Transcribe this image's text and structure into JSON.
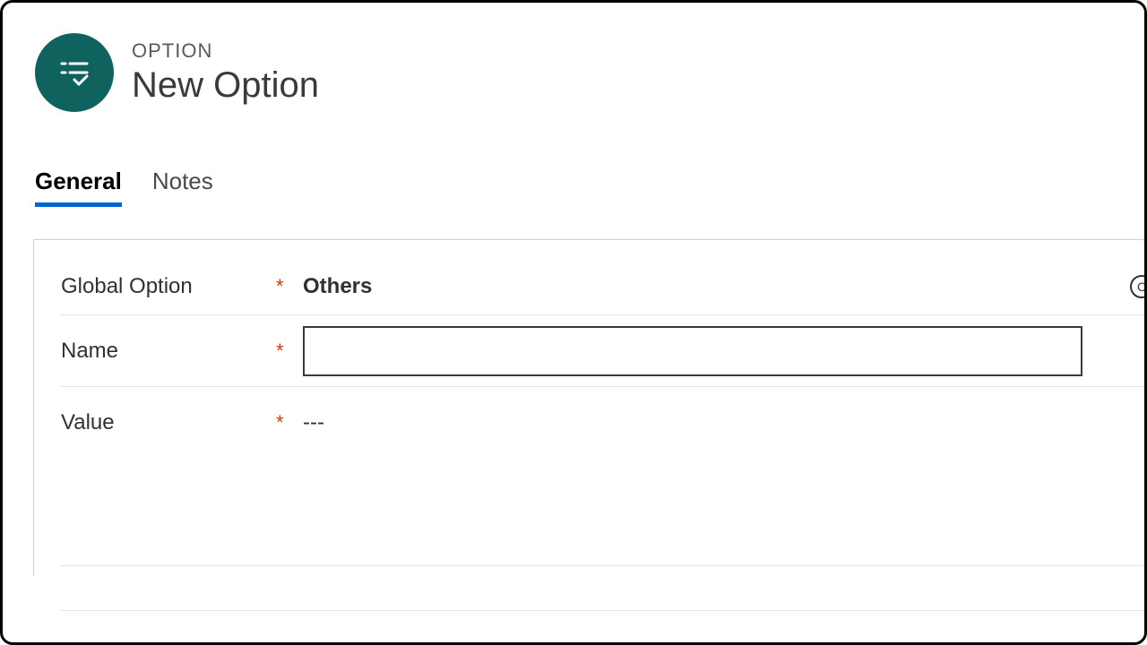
{
  "header": {
    "kicker": "OPTION",
    "title": "New Option"
  },
  "tabs": [
    {
      "label": "General",
      "active": true
    },
    {
      "label": "Notes",
      "active": false
    }
  ],
  "form": {
    "global_option": {
      "label": "Global Option",
      "required": "*",
      "value": "Others"
    },
    "name": {
      "label": "Name",
      "required": "*",
      "value": ""
    },
    "value": {
      "label": "Value",
      "required": "*",
      "display": "---"
    }
  }
}
